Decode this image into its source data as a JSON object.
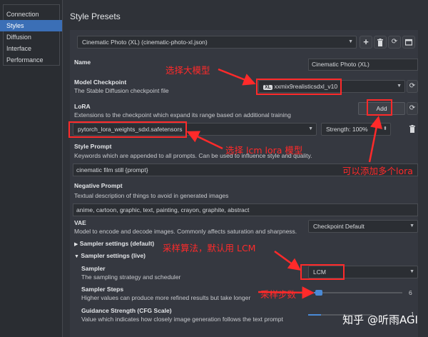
{
  "sidebar": {
    "items": [
      {
        "label": "Connection"
      },
      {
        "label": "Styles"
      },
      {
        "label": "Diffusion"
      },
      {
        "label": "Interface"
      },
      {
        "label": "Performance"
      }
    ]
  },
  "page": {
    "title": "Style Presets",
    "preset_value": "Cinematic Photo (XL) (cinematic-photo-xl.json)"
  },
  "name": {
    "label": "Name",
    "value": "Cinematic Photo (XL)"
  },
  "checkpoint": {
    "label": "Model Checkpoint",
    "desc": "The Stable Diffusion checkpoint file",
    "badge": "XL",
    "value": "xxmix9realisticsdxl_v10"
  },
  "lora": {
    "label": "LoRA",
    "desc": "Extensions to the checkpoint which expand its range based on additional training",
    "add_label": "Add",
    "value": "pytorch_lora_weights_sdxl.safetensors",
    "strength": "Strength: 100%"
  },
  "style_prompt": {
    "label": "Style Prompt",
    "desc": "Keywords which are appended to all prompts. Can be used to influence style and quality.",
    "value": "cinematic film still {prompt}"
  },
  "negative_prompt": {
    "label": "Negative Prompt",
    "desc": "Textual description of things to avoid in generated images",
    "value": "anime, cartoon, graphic, text, painting, crayon, graphite, abstract"
  },
  "vae": {
    "label": "VAE",
    "desc": "Model to encode and decode images. Commonly affects saturation and sharpness.",
    "value": "Checkpoint Default"
  },
  "sampler_default": {
    "label": "Sampler settings (default)"
  },
  "sampler_live": {
    "label": "Sampler settings (live)"
  },
  "sampler": {
    "label": "Sampler",
    "desc": "The sampling strategy and scheduler",
    "value": "LCM"
  },
  "sampler_steps": {
    "label": "Sampler Steps",
    "desc": "Higher values can produce more refined results but take longer",
    "value": "6",
    "fraction": 0.06
  },
  "guidance": {
    "label": "Guidance Strength (CFG Scale)",
    "desc": "Value which indicates how closely image generation follows the text prompt",
    "value": "1"
  },
  "annotations": {
    "big_model": "选择大模型",
    "add_lora": "可以添加多个lora",
    "lcm_lora": "选择 lcm lora 模型",
    "sampler_algo": "采样算法，默认用 LCM",
    "steps": "采样步数"
  },
  "watermark": "知乎 @听雨AGI",
  "colors": {
    "accent": "#3b6fb6",
    "annotation": "#ff2a2a",
    "slider": "#4a8ad6"
  }
}
